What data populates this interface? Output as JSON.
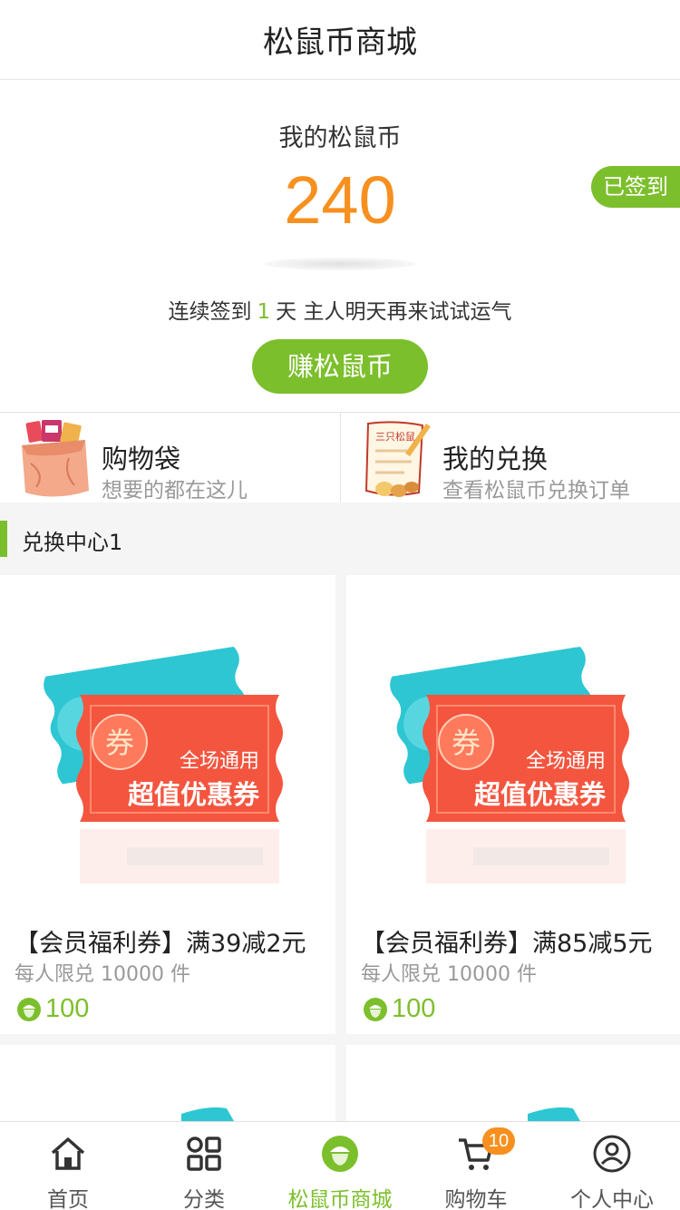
{
  "header": {
    "title": "松鼠币商城"
  },
  "coins": {
    "label": "我的松鼠币",
    "value": "240",
    "signed_badge": "已签到",
    "streak_prefix": "连续签到",
    "streak_days": "1",
    "streak_suffix": "天 主人明天再来试试运气",
    "earn_button": "赚松鼠币"
  },
  "shortcuts": [
    {
      "title": "购物袋",
      "subtitle": "想要的都在这儿",
      "icon": "shopping-bag-icon"
    },
    {
      "title": "我的兑换",
      "subtitle": "查看松鼠币兑换订单",
      "icon": "exchange-list-icon"
    }
  ],
  "section": {
    "title": "兑换中心1"
  },
  "products": [
    {
      "coupon_text_small": "全场通用",
      "coupon_text_big": "超值优惠券",
      "coupon_stamp": "券",
      "name": "【会员福利券】满39减2元",
      "limit": "每人限兑 10000 件",
      "price": "100"
    },
    {
      "coupon_text_small": "全场通用",
      "coupon_text_big": "超值优惠券",
      "coupon_stamp": "券",
      "name": "【会员福利券】满85减5元",
      "limit": "每人限兑 10000 件",
      "price": "100"
    }
  ],
  "tabbar": {
    "items": [
      {
        "label": "首页",
        "icon": "home-icon"
      },
      {
        "label": "分类",
        "icon": "grid-icon"
      },
      {
        "label": "松鼠币商城",
        "icon": "acorn-coin-icon",
        "active": true
      },
      {
        "label": "购物车",
        "icon": "cart-icon",
        "badge": "10"
      },
      {
        "label": "个人中心",
        "icon": "user-icon"
      }
    ]
  },
  "colors": {
    "accent": "#7cbf2c",
    "coin": "#f7901e",
    "coupon_red": "#f4553f",
    "coupon_teal": "#2ec6d3"
  }
}
